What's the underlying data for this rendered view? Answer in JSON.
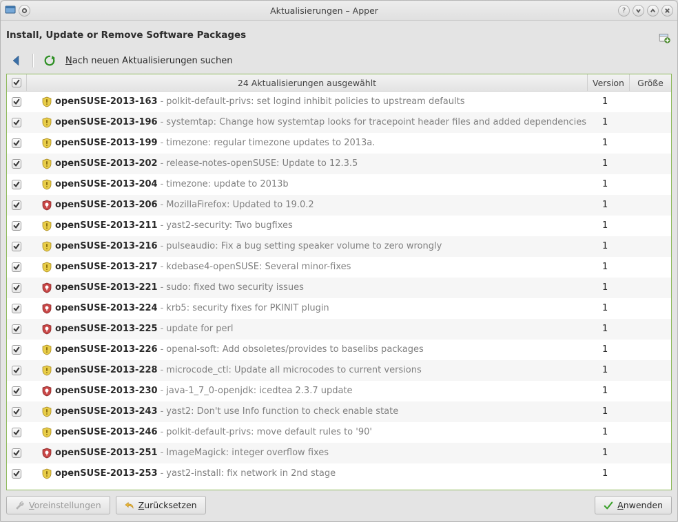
{
  "window": {
    "title": "Aktualisierungen – Apper"
  },
  "page": {
    "title": "Install, Update or Remove Software Packages"
  },
  "toolbar": {
    "refresh_prefix": "N",
    "refresh_rest": "ach neuen Aktualisierungen suchen"
  },
  "updates_header": {
    "selected_label": "24 Aktualisierungen ausgewählt",
    "version_label": "Version",
    "size_label": "Größe"
  },
  "updates": [
    {
      "id": "openSUSE-2013-163",
      "desc": "polkit-default-privs: set logind inhibit policies to upstream defaults",
      "type": "rec",
      "version": "1"
    },
    {
      "id": "openSUSE-2013-196",
      "desc": "systemtap: Change how systemtap looks for tracepoint header files and added dependencies",
      "type": "rec",
      "version": "1"
    },
    {
      "id": "openSUSE-2013-199",
      "desc": "timezone: regular timezone updates to 2013a.",
      "type": "rec",
      "version": "1"
    },
    {
      "id": "openSUSE-2013-202",
      "desc": "release-notes-openSUSE: Update to 12.3.5",
      "type": "rec",
      "version": "1"
    },
    {
      "id": "openSUSE-2013-204",
      "desc": "timezone: update to 2013b",
      "type": "rec",
      "version": "1"
    },
    {
      "id": "openSUSE-2013-206",
      "desc": "MozillaFirefox: Updated to 19.0.2",
      "type": "sec",
      "version": "1"
    },
    {
      "id": "openSUSE-2013-211",
      "desc": "yast2-security: Two bugfixes",
      "type": "rec",
      "version": "1"
    },
    {
      "id": "openSUSE-2013-216",
      "desc": "pulseaudio: Fix a bug setting speaker volume to zero wrongly",
      "type": "rec",
      "version": "1"
    },
    {
      "id": "openSUSE-2013-217",
      "desc": "kdebase4-openSUSE: Several minor-fixes",
      "type": "rec",
      "version": "1"
    },
    {
      "id": "openSUSE-2013-221",
      "desc": "sudo: fixed two security issues",
      "type": "sec",
      "version": "1"
    },
    {
      "id": "openSUSE-2013-224",
      "desc": "krb5: security fixes for PKINIT plugin",
      "type": "sec",
      "version": "1"
    },
    {
      "id": "openSUSE-2013-225",
      "desc": "update for perl",
      "type": "sec",
      "version": "1"
    },
    {
      "id": "openSUSE-2013-226",
      "desc": "openal-soft: Add obsoletes/provides to baselibs packages",
      "type": "rec",
      "version": "1"
    },
    {
      "id": "openSUSE-2013-228",
      "desc": "microcode_ctl: Update all microcodes to current versions",
      "type": "rec",
      "version": "1"
    },
    {
      "id": "openSUSE-2013-230",
      "desc": "java-1_7_0-openjdk: icedtea 2.3.7 update",
      "type": "sec",
      "version": "1"
    },
    {
      "id": "openSUSE-2013-243",
      "desc": "yast2: Don't use Info function to check enable state",
      "type": "rec",
      "version": "1"
    },
    {
      "id": "openSUSE-2013-246",
      "desc": "polkit-default-privs: move default rules to '90'",
      "type": "rec",
      "version": "1"
    },
    {
      "id": "openSUSE-2013-251",
      "desc": "ImageMagick: integer overflow fixes",
      "type": "sec",
      "version": "1"
    },
    {
      "id": "openSUSE-2013-253",
      "desc": "yast2-install: fix network in 2nd stage",
      "type": "rec",
      "version": "1"
    }
  ],
  "buttons": {
    "settings_prefix": "V",
    "settings_rest": "oreinstellungen",
    "reset_prefix": "Z",
    "reset_rest": "urücksetzen",
    "apply_prefix": "A",
    "apply_rest": "nwenden"
  }
}
